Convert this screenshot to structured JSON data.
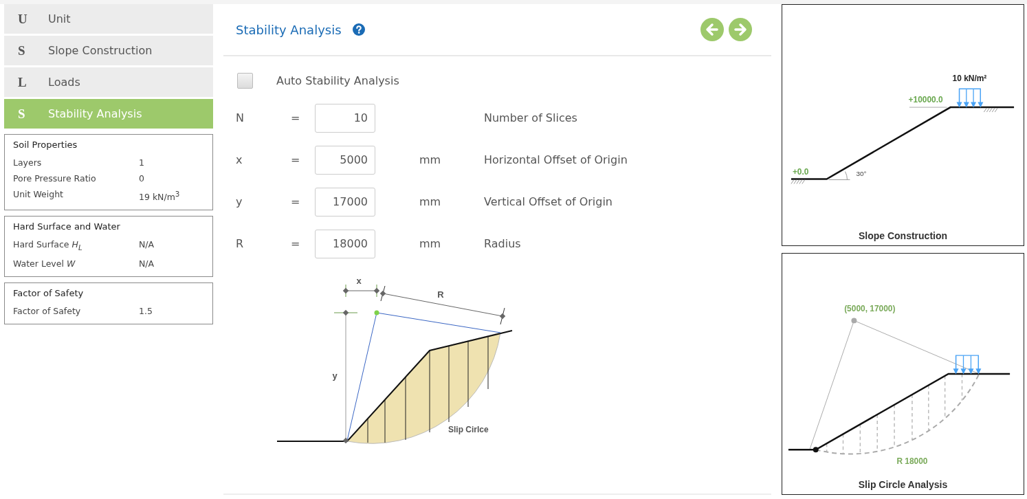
{
  "nav": [
    {
      "letter": "U",
      "label": "Unit",
      "selected": false
    },
    {
      "letter": "S",
      "label": "Slope Construction",
      "selected": false
    },
    {
      "letter": "L",
      "label": "Loads",
      "selected": false
    },
    {
      "letter": "S",
      "label": "Stability Analysis",
      "selected": true
    }
  ],
  "info_boxes": [
    {
      "title": "Soil Properties",
      "rows": [
        {
          "label": "Layers",
          "value": "1"
        },
        {
          "label": "Pore Pressure Ratio",
          "value": "0"
        },
        {
          "label": "Unit Weight",
          "value": "19 kN/m$^{3}$"
        }
      ]
    },
    {
      "title": "Hard Surface and Water",
      "rows": [
        {
          "label": "Hard Surface *H*$_{L}$",
          "value": "N/A"
        },
        {
          "label": "Water Level *W*",
          "value": "N/A"
        }
      ]
    },
    {
      "title": "Factor of Safety",
      "rows": [
        {
          "label": "Factor of Safety",
          "value": "1.5"
        }
      ]
    }
  ],
  "main": {
    "title": "Stability Analysis",
    "auto_checkbox": {
      "label": "Auto Stability Analysis",
      "checked": false
    },
    "params": [
      {
        "symbol": "N",
        "value": "10",
        "description": "Number of Slices"
      },
      {
        "symbol": "x",
        "value": "5000",
        "unit": "mm",
        "description": "Horizontal Offset of Origin"
      },
      {
        "symbol": "y",
        "value": "17000",
        "unit": "mm",
        "description": "Vertical Offset of Origin"
      },
      {
        "symbol": "R",
        "value": "18000",
        "unit": "mm",
        "description": "Radius"
      }
    ],
    "equals": "=",
    "diagram": {
      "x_label": "x",
      "r_label": "R",
      "y_label": "y",
      "slip_label": "Slip Cirlce"
    }
  },
  "slope_panel": {
    "load": "10 kN/m²",
    "top_level": "+10000.0",
    "bottom_level": "+0.0",
    "angle": "30°",
    "caption": "Slope Construction"
  },
  "slip_panel": {
    "center": "(5000, 17000)",
    "radius": "R 18000",
    "caption": "Slip Circle Analysis"
  }
}
